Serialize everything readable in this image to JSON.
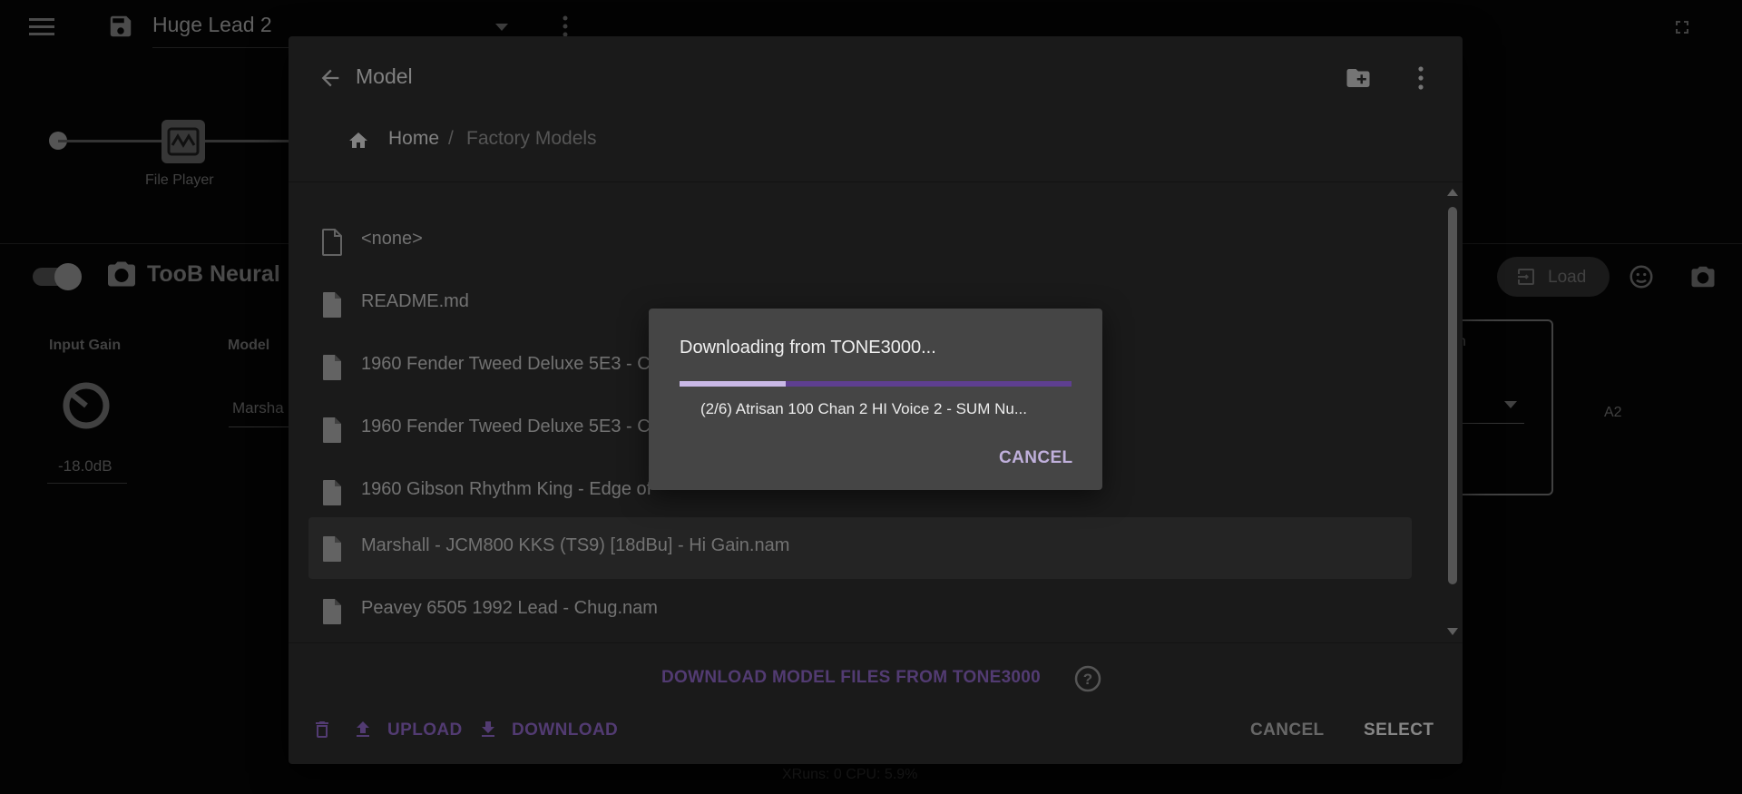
{
  "app": {
    "preset_name": "Huge Lead 2",
    "chain_node_label": "File Player",
    "plugin_name": "TooB Neural",
    "load_label": "Load",
    "input_gain_label": "Input Gain",
    "input_gain_value": "-18.0dB",
    "model_label": "Model",
    "model_value": "Marsha",
    "right_label_partial": "on",
    "right_value": "A2",
    "status_text": "XRuns: 0  CPU: 5.9%"
  },
  "dialog": {
    "title": "Model",
    "breadcrumb": {
      "home": "Home",
      "separator": "/",
      "current": "Factory Models"
    },
    "files": [
      {
        "label": "<none>",
        "selected": false
      },
      {
        "label": "README.md",
        "selected": false
      },
      {
        "label": "1960 Fender Tweed Deluxe 5E3 - C",
        "selected": false
      },
      {
        "label": "1960 Fender Tweed Deluxe 5E3 - C",
        "selected": false
      },
      {
        "label": "1960 Gibson Rhythm King - Edge of",
        "selected": false
      },
      {
        "label": "Marshall - JCM800 KKS (TS9) [18dBu] - Hi Gain.nam",
        "selected": true
      },
      {
        "label": "Peavey 6505 1992 Lead - Chug.nam",
        "selected": false
      }
    ],
    "download_link": "DOWNLOAD MODEL FILES FROM TONE3000",
    "upload_label": "UPLOAD",
    "download_label": "DOWNLOAD",
    "cancel_label": "CANCEL",
    "select_label": "SELECT"
  },
  "progress": {
    "title": "Downloading from TONE3000...",
    "fraction": 0.27,
    "file_text": "(2/6) Atrisan 100 Chan 2 HI Voice 2 - SUM Nu...",
    "cancel_label": "CANCEL"
  },
  "colors": {
    "accent": "#8560b8",
    "progress_fill": "#c9b8e6",
    "progress_track": "#5e3f90"
  }
}
